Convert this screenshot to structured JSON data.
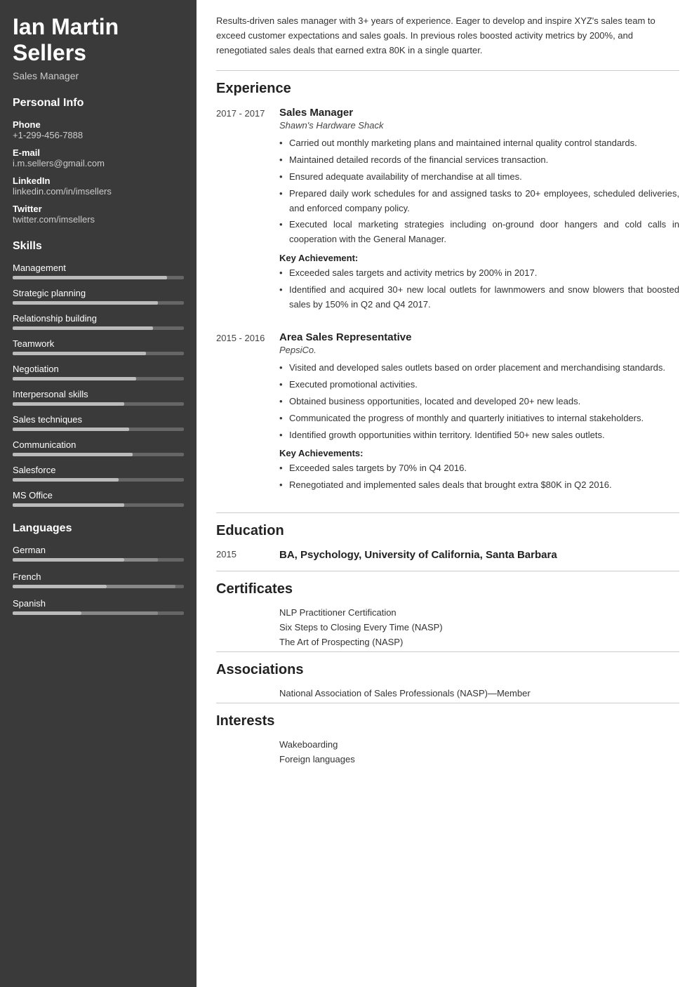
{
  "sidebar": {
    "name": "Ian Martin Sellers",
    "job_title": "Sales Manager",
    "personal_info": {
      "section_title": "Personal Info",
      "phone_label": "Phone",
      "phone_value": "+1-299-456-7888",
      "email_label": "E-mail",
      "email_value": "i.m.sellers@gmail.com",
      "linkedin_label": "LinkedIn",
      "linkedin_value": "linkedin.com/in/imsellers",
      "twitter_label": "Twitter",
      "twitter_value": "twitter.com/imsellers"
    },
    "skills": {
      "section_title": "Skills",
      "items": [
        {
          "name": "Management",
          "fill_pct": 90
        },
        {
          "name": "Strategic planning",
          "fill_pct": 85
        },
        {
          "name": "Relationship building",
          "fill_pct": 82
        },
        {
          "name": "Teamwork",
          "fill_pct": 78
        },
        {
          "name": "Negotiation",
          "fill_pct": 72
        },
        {
          "name": "Interpersonal skills",
          "fill_pct": 65
        },
        {
          "name": "Sales techniques",
          "fill_pct": 68
        },
        {
          "name": "Communication",
          "fill_pct": 70
        },
        {
          "name": "Salesforce",
          "fill_pct": 62
        },
        {
          "name": "MS Office",
          "fill_pct": 65
        }
      ]
    },
    "languages": {
      "section_title": "Languages",
      "items": [
        {
          "name": "German",
          "fill_pct": 65,
          "accent_pct": 20,
          "accent_left_pct": 65
        },
        {
          "name": "French",
          "fill_pct": 55,
          "accent_pct": 40,
          "accent_left_pct": 55
        },
        {
          "name": "Spanish",
          "fill_pct": 40,
          "accent_pct": 45,
          "accent_left_pct": 40
        }
      ]
    }
  },
  "main": {
    "summary": "Results-driven sales manager with 3+ years of experience. Eager to develop and inspire XYZ's sales team to exceed customer expectations and sales goals. In previous roles boosted activity metrics by 200%, and renegotiated sales deals that earned extra 80K in a single quarter.",
    "experience": {
      "section_title": "Experience",
      "jobs": [
        {
          "date": "2017 - 2017",
          "title": "Sales Manager",
          "company": "Shawn's Hardware Shack",
          "bullets": [
            "Carried out monthly marketing plans and maintained internal quality control standards.",
            "Maintained detailed records of the financial services transaction.",
            "Ensured adequate availability of merchandise at all times.",
            "Prepared daily work schedules for and assigned tasks to 20+ employees, scheduled deliveries, and enforced company policy.",
            "Executed local marketing strategies including on-ground door hangers and cold calls in cooperation with the General Manager."
          ],
          "key_achievement_label": "Key Achievement:",
          "achievements": [
            "Exceeded sales targets and activity metrics by 200% in 2017.",
            "Identified and acquired 30+ new local outlets for lawnmowers and snow blowers that boosted sales by 150% in Q2 and Q4 2017."
          ]
        },
        {
          "date": "2015 - 2016",
          "title": "Area Sales Representative",
          "company": "PepsiCo.",
          "bullets": [
            "Visited and developed sales outlets based on order placement and merchandising standards.",
            "Executed promotional activities.",
            "Obtained business opportunities, located and developed 20+ new leads.",
            "Communicated the progress of monthly and quarterly initiatives to internal stakeholders.",
            "Identified growth opportunities within territory. Identified 50+ new sales outlets."
          ],
          "key_achievement_label": "Key Achievements:",
          "achievements": [
            "Exceeded sales targets by 70% in Q4 2016.",
            "Renegotiated and implemented sales deals that brought extra $80K in Q2 2016."
          ]
        }
      ]
    },
    "education": {
      "section_title": "Education",
      "items": [
        {
          "date": "2015",
          "degree": "BA, Psychology, University of California, Santa Barbara"
        }
      ]
    },
    "certificates": {
      "section_title": "Certificates",
      "items": [
        "NLP Practitioner Certification",
        "Six Steps to Closing Every Time (NASP)",
        "The Art of Prospecting (NASP)"
      ]
    },
    "associations": {
      "section_title": "Associations",
      "items": [
        "National Association of Sales Professionals (NASP)—Member"
      ]
    },
    "interests": {
      "section_title": "Interests",
      "items": [
        "Wakeboarding",
        "Foreign languages"
      ]
    }
  }
}
